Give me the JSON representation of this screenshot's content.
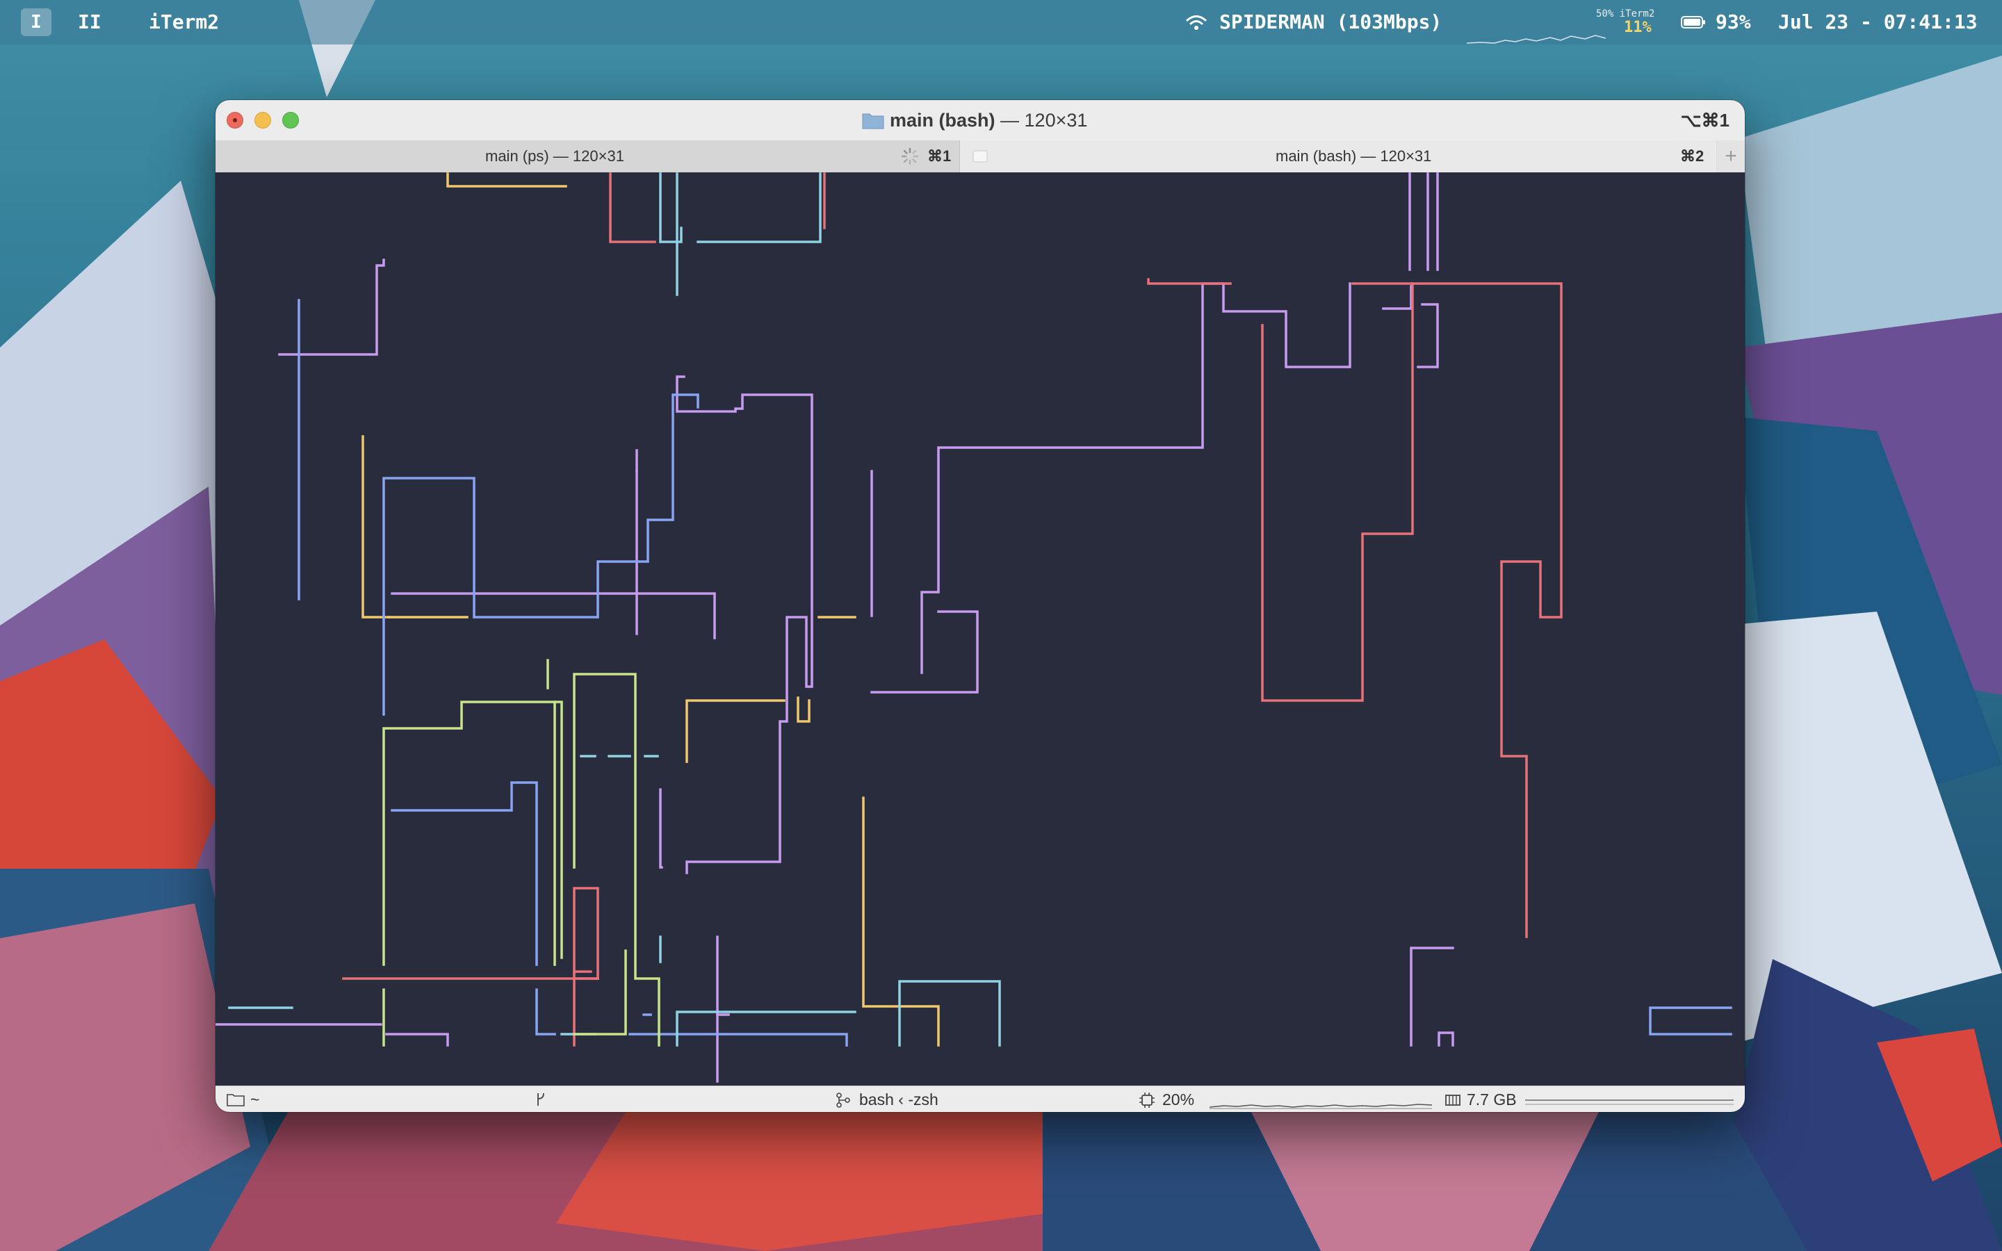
{
  "menubar": {
    "workspace_1": "I",
    "workspace_2": "II",
    "app_name": "iTerm2",
    "network": "SPIDERMAN (103Mbps)",
    "cpu_mini_label": "50% iTerm2",
    "cpu_mini_value": "11%",
    "battery": "93%",
    "clock": "Jul 23 - 07:41:13",
    "icons": [
      "wifi-icon",
      "battery-icon"
    ]
  },
  "window": {
    "title_bold": "main (bash)",
    "title_rest": " — 120×31",
    "shortcut": "⌥⌘1",
    "tabs": [
      {
        "label": "main (ps)  — 120×31",
        "shortcut": "⌘1",
        "active": false
      },
      {
        "label": "main (bash)  — 120×31",
        "shortcut": "⌘2",
        "active": true
      }
    ],
    "new_tab_label": "+"
  },
  "statusbar": {
    "directory": "~",
    "job": "bash ‹ -zsh",
    "cpu": "20%",
    "memory": "7.7 GB"
  },
  "theme": {
    "terminal_bg": "#292c3c",
    "pipe_colors": {
      "purple": "#c69bf0",
      "red": "#e8727a",
      "yellow": "#f1c76e",
      "blue": "#8aa4f4",
      "cyan": "#8fd2e6",
      "green": "#c8e48a"
    }
  }
}
